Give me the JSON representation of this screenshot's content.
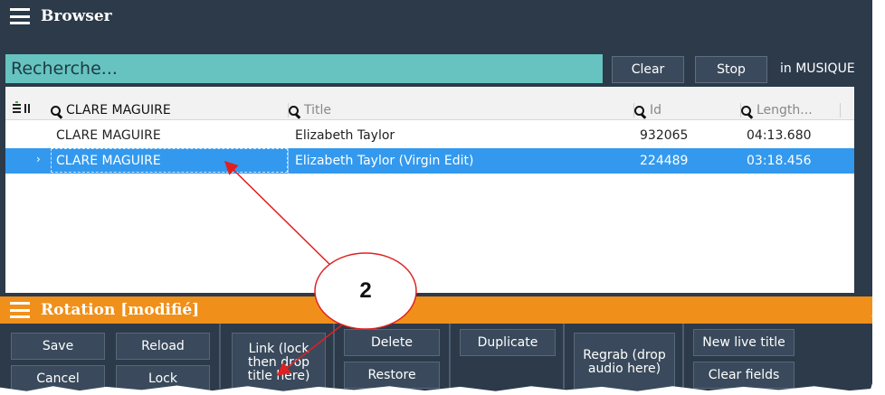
{
  "browser": {
    "title": "Browser"
  },
  "search": {
    "placeholder": "Recherche...",
    "clear_label": "Clear",
    "stop_label": "Stop",
    "scope_label": "in MUSIQUE"
  },
  "table": {
    "columns": {
      "artist": "CLARE MAGUIRE",
      "title": "Title",
      "id": "Id",
      "length": "Length..."
    },
    "rows": [
      {
        "artist": "CLARE MAGUIRE",
        "title": "Elizabeth Taylor",
        "id": "932065",
        "length": "04:13.680",
        "selected": false
      },
      {
        "artist": "CLARE MAGUIRE",
        "title": "Elizabeth Taylor (Virgin Edit)",
        "id": "224489",
        "length": "03:18.456",
        "selected": true
      }
    ]
  },
  "rotation": {
    "title": "Rotation [modifié]",
    "buttons": {
      "save": "Save",
      "reload": "Reload",
      "cancel": "Cancel",
      "lock": "Lock",
      "link": "Link (lock then drop title here)",
      "delete": "Delete",
      "restore": "Restore",
      "duplicate": "Duplicate",
      "regrab": "Regrab (drop audio here)",
      "new_live_title": "New live title",
      "clear_fields": "Clear fields"
    }
  },
  "annotation": {
    "callout_number": "2",
    "arrow_color": "#e02020"
  },
  "colors": {
    "panel_bg": "#2c3a4a",
    "search_bg": "#66c3c0",
    "selection": "#3399ee",
    "rotation_header": "#f0901a"
  }
}
